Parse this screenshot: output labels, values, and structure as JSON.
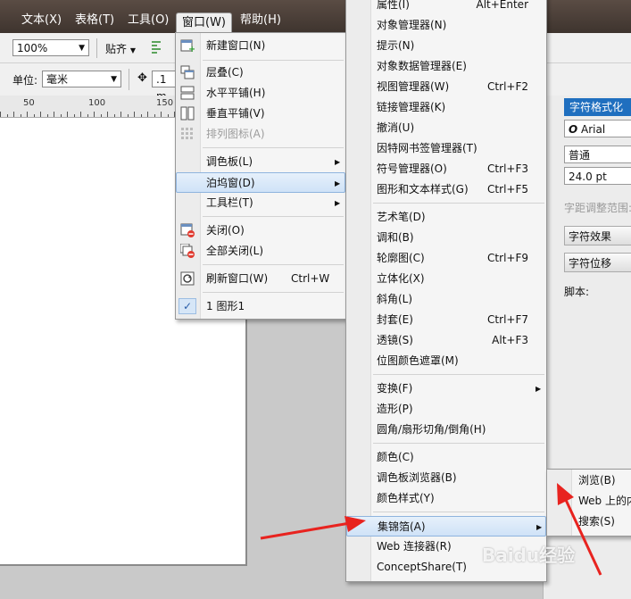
{
  "menubar": {
    "items": [
      "文本(X)",
      "表格(T)",
      "工具(O)",
      "窗口(W)",
      "帮助(H)"
    ]
  },
  "toolbar": {
    "zoom": "100%",
    "snap_label": "贴齐",
    "units_label": "单位:",
    "units_value": "毫米",
    "nudge_value": ".1 m"
  },
  "ruler": {
    "labels": [
      "50",
      "100",
      "150"
    ]
  },
  "window_menu": {
    "items": [
      {
        "label": "新建窗口(N)",
        "icon": "new-window-icon"
      },
      {
        "label": "层叠(C)",
        "icon": "cascade-icon"
      },
      {
        "label": "水平平铺(H)",
        "icon": "tile-horizontal-icon"
      },
      {
        "label": "垂直平铺(V)",
        "icon": "tile-vertical-icon"
      },
      {
        "label": "排列图标(A)",
        "icon": "arrange-icons-icon",
        "disabled": true
      },
      {
        "label": "调色板(L)",
        "submenu": true
      },
      {
        "label": "泊坞窗(D)",
        "submenu": true,
        "highlighted": true
      },
      {
        "label": "工具栏(T)",
        "submenu": true
      },
      {
        "label": "关闭(O)",
        "icon": "close-window-icon"
      },
      {
        "label": "全部关闭(L)",
        "icon": "close-all-icon"
      },
      {
        "label": "刷新窗口(W)",
        "shortcut": "Ctrl+W",
        "icon": "refresh-icon"
      },
      {
        "label": "1 图形1",
        "checked": true
      }
    ]
  },
  "docker_menu": {
    "items": [
      {
        "label": "属性(I)",
        "shortcut": "Alt+Enter"
      },
      {
        "label": "对象管理器(N)"
      },
      {
        "label": "提示(N)"
      },
      {
        "label": "对象数据管理器(E)"
      },
      {
        "label": "视图管理器(W)",
        "shortcut": "Ctrl+F2"
      },
      {
        "label": "链接管理器(K)"
      },
      {
        "label": "撤消(U)"
      },
      {
        "label": "因特网书签管理器(T)"
      },
      {
        "label": "符号管理器(O)",
        "shortcut": "Ctrl+F3"
      },
      {
        "label": "图形和文本样式(G)",
        "shortcut": "Ctrl+F5"
      },
      {
        "label": "艺术笔(D)"
      },
      {
        "label": "调和(B)"
      },
      {
        "label": "轮廓图(C)",
        "shortcut": "Ctrl+F9"
      },
      {
        "label": "立体化(X)"
      },
      {
        "label": "斜角(L)"
      },
      {
        "label": "封套(E)",
        "shortcut": "Ctrl+F7"
      },
      {
        "label": "透镜(S)",
        "shortcut": "Alt+F3"
      },
      {
        "label": "位图颜色遮罩(M)"
      },
      {
        "label": "变换(F)",
        "submenu": true
      },
      {
        "label": "造形(P)"
      },
      {
        "label": "圆角/扇形切角/倒角(H)"
      },
      {
        "label": "颜色(C)"
      },
      {
        "label": "调色板浏览器(B)"
      },
      {
        "label": "颜色样式(Y)"
      },
      {
        "label": "集锦箔(A)",
        "submenu": true,
        "highlighted": true
      },
      {
        "label": "Web 连接器(R)"
      },
      {
        "label": "ConceptShare(T)"
      }
    ]
  },
  "gallery_submenu": {
    "items": [
      "浏览(B)",
      "Web 上的内",
      "搜索(S)"
    ]
  },
  "char_docker": {
    "title": "字符格式化",
    "font": "Arial",
    "style": "普通",
    "size": "24.0 pt",
    "range_label": "字距调整范围:",
    "effects_btn": "字符效果",
    "position_btn": "字符位移",
    "script_label": "脚本:"
  },
  "watermark": "Baidu经验",
  "colors": {
    "highlight": "#cfe2f7",
    "arrow": "#e8231f",
    "title_bar": "#1f6fbf"
  }
}
